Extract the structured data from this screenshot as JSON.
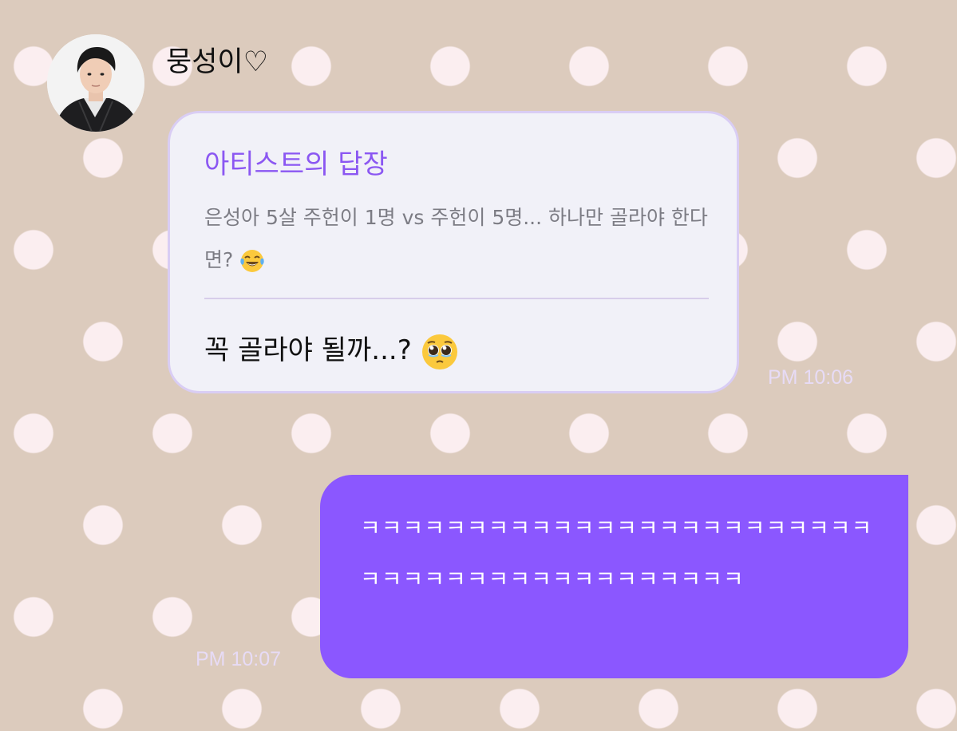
{
  "sender": {
    "name": "뭉성이♡",
    "avatar_icon": "profile-photo-avatar"
  },
  "reply_card": {
    "title": "아티스트의 답장",
    "quote": "은성아 5살 주헌이 1명 vs 주헌이 5명... 하나만 골라야 한다면?",
    "quote_emoji": "face-with-tears-of-joy-icon",
    "message": "꼭 골라야 될까...?",
    "message_emoji": "pleading-face-icon",
    "time": "PM 10:06"
  },
  "my_message": {
    "text": "ㅋㅋㅋㅋㅋㅋㅋㅋㅋㅋㅋㅋㅋㅋㅋㅋㅋㅋㅋㅋㅋㅋㅋㅋㅋㅋㅋㅋㅋㅋㅋㅋㅋㅋㅋㅋㅋㅋㅋㅋㅋㅋ",
    "time": "PM 10:07"
  },
  "colors": {
    "background": "#dccbbd",
    "polka_dot": "#fbeef0",
    "reply_bubble": "#f1f1f8",
    "reply_border": "#d9cdf4",
    "accent_purple": "#8b57f2",
    "my_bubble": "#8b57ff",
    "timestamp": "#e7dbf6"
  }
}
